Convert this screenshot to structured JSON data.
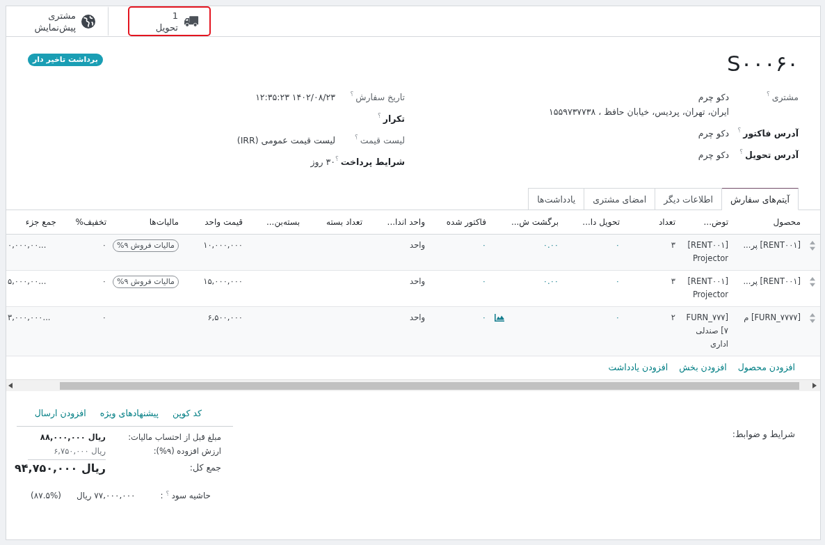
{
  "buttons": [
    {
      "kind": "delivery",
      "value": "1",
      "label": "تحویل",
      "highlighted": true
    },
    {
      "kind": "preview",
      "value": "مشتری",
      "label": "پیش‌نمایش",
      "highlighted": false
    }
  ],
  "order": {
    "name": "S۰۰۰۶۰",
    "badge": "برداشت تاخیر دار"
  },
  "groups": [
    {
      "fields": [
        {
          "label": "مشتری",
          "help": "؟",
          "required": false,
          "lines": [
            "دکو چرم",
            "ایران، تهران، پردیس، خیابان حافظ ، ۱۵۵۹۷۳۷۷۳۸"
          ]
        },
        {
          "label": "آدرس فاکتور",
          "help": "؟",
          "required": true,
          "lines": [
            "دکو چرم"
          ]
        },
        {
          "label": "آدرس تحویل",
          "help": "؟",
          "required": true,
          "lines": [
            "دکو چرم"
          ]
        }
      ]
    },
    {
      "fields": [
        {
          "label": "تاریخ سفارش",
          "help": "؟",
          "required": false,
          "lines": [
            "۱۴۰۲/۰۸/۲۳ ۱۲:۳۵:۲۳"
          ]
        },
        {
          "label": "تکرار",
          "help": "؟",
          "required": true
        },
        {
          "label": "لیست قیمت",
          "help": "؟",
          "required": false,
          "lines": [
            "لیست قیمت عمومی (IRR)"
          ]
        },
        {
          "label": "شرایط پرداخت",
          "help": "؟",
          "required": true,
          "lines": [
            "۳۰ روز"
          ]
        }
      ]
    }
  ],
  "tabs": [
    {
      "label": "آیتم‌های سفارش",
      "selected": true
    },
    {
      "label": "اطلاعات دیگر",
      "selected": false
    },
    {
      "label": "امضای مشتری",
      "selected": false
    },
    {
      "label": "یادداشت‌ها",
      "selected": false
    }
  ],
  "order_lines": {
    "columns": [
      "محصول",
      "توض...",
      "تعداد",
      "تحویل دا...",
      "برگشت ش...",
      "فاکتور شده",
      "واحد اندا...",
      "تعداد بسته",
      "بسته‌بن...",
      "قیمت واحد",
      "مالیات‌ها",
      "تخفیف%",
      "جمع جزء"
    ],
    "rows": [
      {
        "product": "[RENT۰۰۱] پر...",
        "description": "[RENT۰۰۱] Projector",
        "quantity": "۳",
        "delivered": "۰",
        "returned": "۰.۰۰",
        "invoiced": "۰",
        "unit": "واحد",
        "unit_price": "۱۰,۰۰۰,۰۰۰",
        "taxes": [
          "مالیات فروش ۹%"
        ],
        "discount": "۰",
        "subtotal": "۰,۰۰۰,۰۰...",
        "forecast": false
      },
      {
        "product": "[RENT۰۰۱] پر...",
        "description": "[RENT۰۰۱] Projector",
        "quantity": "۳",
        "delivered": "۰",
        "returned": "۰.۰۰",
        "invoiced": "۰",
        "unit": "واحد",
        "unit_price": "۱۵,۰۰۰,۰۰۰",
        "taxes": [
          "مالیات فروش ۹%"
        ],
        "discount": "۰",
        "subtotal": "۵,۰۰۰,۰۰...",
        "forecast": false
      },
      {
        "product": "[FURN_۷۷۷۷] م",
        "description": "[FURN_۷۷۷۷] صندلی اداری",
        "quantity": "۲",
        "delivered": "۰",
        "invoiced": "۰",
        "unit": "واحد",
        "unit_price": "۶,۵۰۰,۰۰۰",
        "discount": "۰",
        "subtotal": "۳,۰۰۰,۰۰۰...",
        "forecast": true
      }
    ],
    "add_links": [
      "افزودن محصول",
      "افزودن بخش",
      "افزودن یادداشت"
    ]
  },
  "terms_label": "شرایط و ضوابط:",
  "totals": {
    "actions": [
      "کد کوپن",
      "پیشنهادهای ویژه",
      "افزودن ارسال"
    ],
    "lines": [
      {
        "kind": "untaxed",
        "label": "مبلغ قبل از احتساب مالیات:",
        "value": "ریال ۸۸,۰۰۰,۰۰۰"
      },
      {
        "kind": "tax",
        "label": "ارزش افزوده (۹%):",
        "value": "ریال ۶,۷۵۰,۰۰۰"
      },
      {
        "kind": "total",
        "label": "جمع کل:",
        "value": "ریال ۹۴,۷۵۰,۰۰۰"
      }
    ],
    "margin": {
      "label": "حاشیه سود",
      "help": "؟",
      "colon": ":",
      "value": "۷۷,۰۰۰,۰۰۰ ریال",
      "percent": "(۸۷.۵%)"
    }
  }
}
